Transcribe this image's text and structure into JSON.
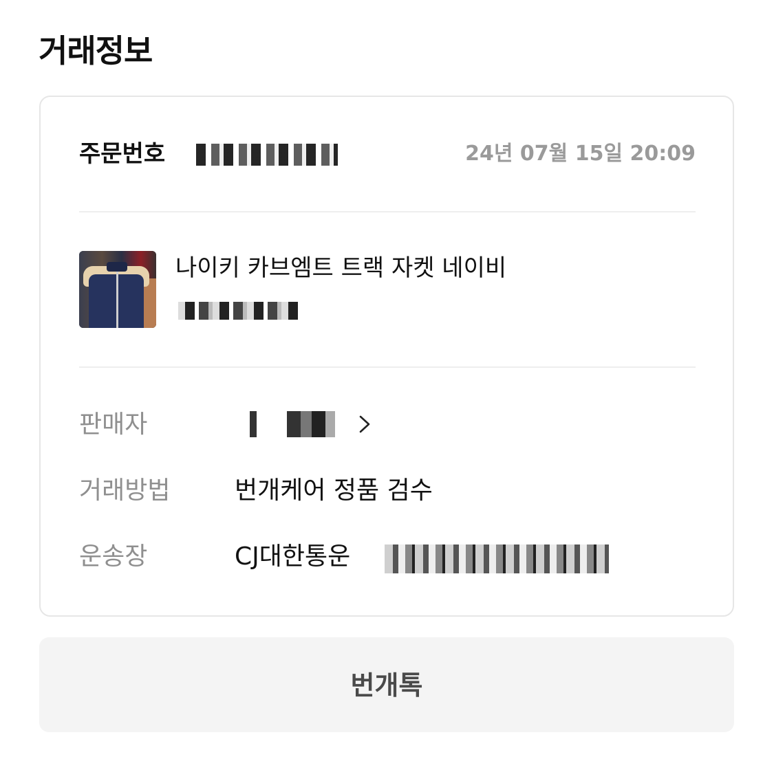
{
  "section": {
    "title": "거래정보"
  },
  "order": {
    "label": "주문번호",
    "date": "24년 07월 15일 20:09"
  },
  "product": {
    "name": "나이키 카브엠트 트랙 자켓 네이비",
    "image_icon": "product-thumbnail"
  },
  "info": {
    "seller_label": "판매자",
    "method_label": "거래방법",
    "method_value": "번개케어 정품 검수",
    "waybill_label": "운송장",
    "carrier": "CJ대한통운"
  },
  "actions": {
    "talk_label": "번개톡"
  },
  "colors": {
    "label_gray": "#8f8f8f",
    "date_gray": "#9a9a9a",
    "button_bg": "#f4f4f4",
    "card_border": "#e6e6e6"
  }
}
